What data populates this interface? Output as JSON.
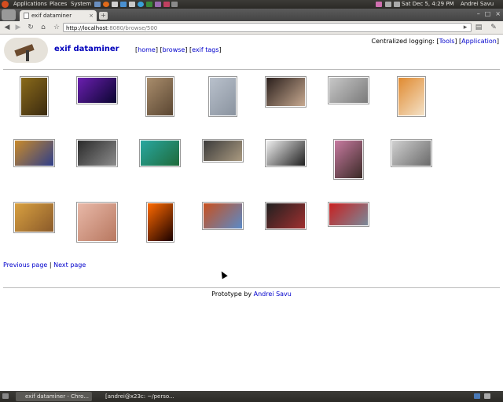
{
  "top_panel": {
    "menus": [
      "Applications",
      "Places",
      "System"
    ],
    "datetime": "Sat Dec  5,  4:29 PM",
    "user": "Andrei Savu"
  },
  "browser": {
    "tab_title": "exif dataminer",
    "new_tab_label": "+",
    "url_host": "http://localhost",
    "url_rest": ":8080/browse/500"
  },
  "site": {
    "title": "exif dataminer",
    "nav": [
      "home",
      "browse",
      "exif tags"
    ],
    "logging_label": "Centralized logging:",
    "logging_links": [
      "Tools",
      "Application"
    ]
  },
  "gallery": {
    "thumb_colors": [
      [
        "#8a6a1a",
        "#3a2a10"
      ],
      [
        "#6b1fb0",
        "#0a0530"
      ],
      [
        "#a98d6c",
        "#5a4632"
      ],
      [
        "#b9c1cc",
        "#8a939f"
      ],
      [
        "#2a1f1c",
        "#c7a990"
      ],
      [
        "#c8c8c8",
        "#7a7a7a"
      ],
      [
        "#e08a30",
        "#f4e2c8"
      ],
      [
        "#c98a2a",
        "#2e3e8a"
      ],
      [
        "#2a2a2a",
        "#8c8c8c"
      ],
      [
        "#28a7a0",
        "#1f6a3a"
      ],
      [
        "#3b3b3b",
        "#aa9a80"
      ],
      [
        "#f0f0f0",
        "#202020"
      ],
      [
        "#c77aa0",
        "#3a2a26"
      ],
      [
        "#d0d0d0",
        "#6a6a6a"
      ],
      [
        "#d8a040",
        "#8a5a2a"
      ],
      [
        "#e8b8a8",
        "#b87860"
      ],
      [
        "#ff6a00",
        "#1a0000"
      ],
      [
        "#c8501e",
        "#5a8ac8"
      ],
      [
        "#202020",
        "#a03030"
      ],
      [
        "#c82020",
        "#7a8a9a"
      ]
    ]
  },
  "pager": {
    "previous": "Previous page",
    "separator": "|",
    "next": "Next page"
  },
  "footer": {
    "prefix": "Prototype by",
    "author": "Andrei Savu"
  },
  "taskbar": {
    "items": [
      "exif dataminer - Chro...",
      "[andrei@x23c: ~/perso..."
    ]
  },
  "colors": {
    "link": "#0000cc",
    "panel": "#3c3b37"
  }
}
